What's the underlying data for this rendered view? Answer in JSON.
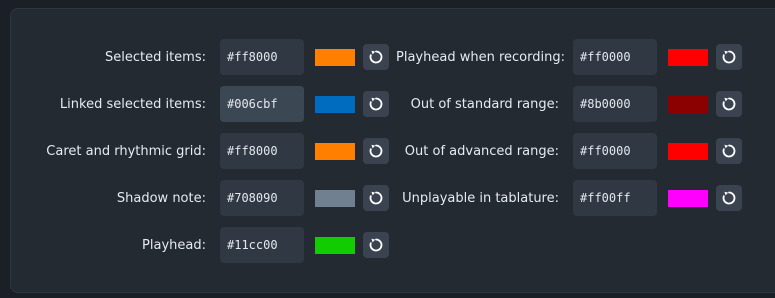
{
  "left_column": [
    {
      "label": "Selected items:",
      "value": "#ff8000",
      "color": "#ff8000",
      "reset_icon": "reset-icon"
    },
    {
      "label": "Linked selected items:",
      "value": "#006cbf",
      "color": "#006cbf",
      "reset_icon": "reset-icon"
    },
    {
      "label": "Caret and rhythmic grid:",
      "value": "#ff8000",
      "color": "#ff8000",
      "reset_icon": "reset-icon"
    },
    {
      "label": "Shadow note:",
      "value": "#708090",
      "color": "#708090",
      "reset_icon": "reset-icon"
    },
    {
      "label": "Playhead:",
      "value": "#11cc00",
      "color": "#11cc00",
      "reset_icon": "reset-icon"
    }
  ],
  "right_column": [
    {
      "label": "Playhead when recording:",
      "value": "#ff0000",
      "color": "#ff0000",
      "reset_icon": "reset-icon"
    },
    {
      "label": "Out of standard range:",
      "value": "#8b0000",
      "color": "#8b0000",
      "reset_icon": "reset-icon"
    },
    {
      "label": "Out of advanced range:",
      "value": "#ff0000",
      "color": "#ff0000",
      "reset_icon": "reset-icon"
    },
    {
      "label": "Unplayable in tablature:",
      "value": "#ff00ff",
      "color": "#ff00ff",
      "reset_icon": "reset-icon"
    }
  ],
  "focused_field": "left_column.1"
}
